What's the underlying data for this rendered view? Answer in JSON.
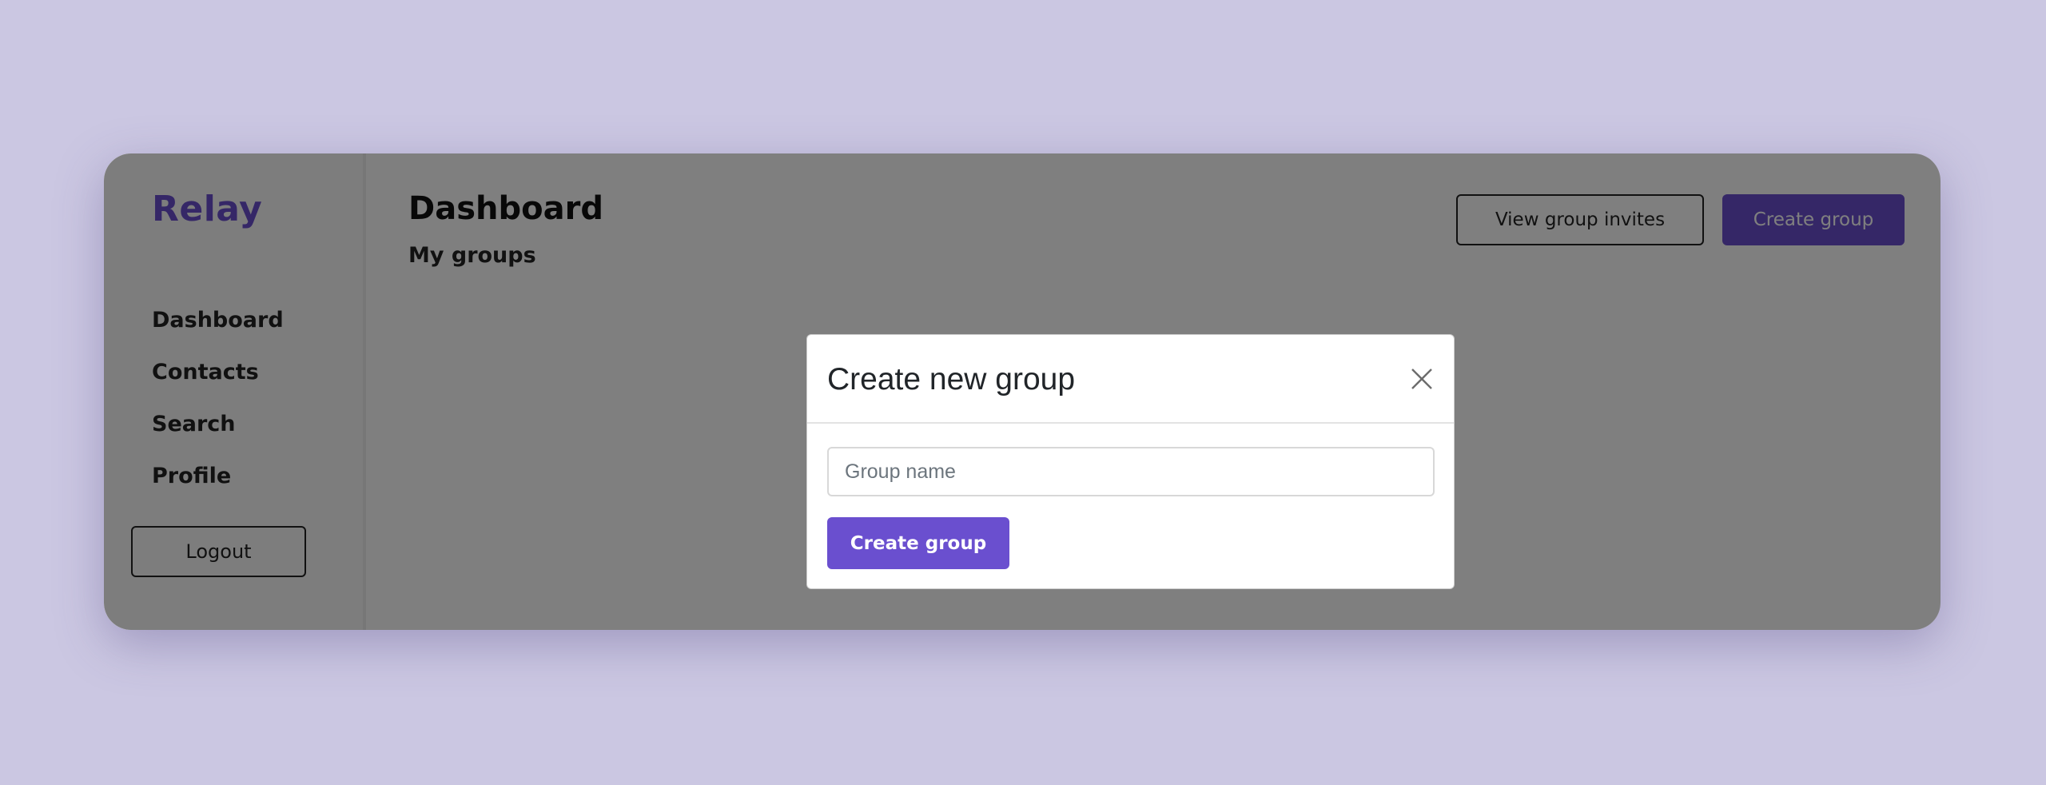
{
  "app": {
    "brand": "Relay"
  },
  "sidebar": {
    "items": [
      {
        "label": "Dashboard"
      },
      {
        "label": "Contacts"
      },
      {
        "label": "Search"
      },
      {
        "label": "Profile"
      }
    ],
    "logout_label": "Logout"
  },
  "main": {
    "title": "Dashboard",
    "section_title": "My groups",
    "view_invites_label": "View group invites",
    "create_group_label": "Create group"
  },
  "modal": {
    "title": "Create new group",
    "close_icon": "close-icon",
    "input_placeholder": "Group name",
    "input_value": "",
    "submit_label": "Create group"
  },
  "colors": {
    "accent": "#6a4fcf",
    "page_background": "#cbc7e2",
    "overlay": "rgba(0,0,0,0.5)"
  }
}
